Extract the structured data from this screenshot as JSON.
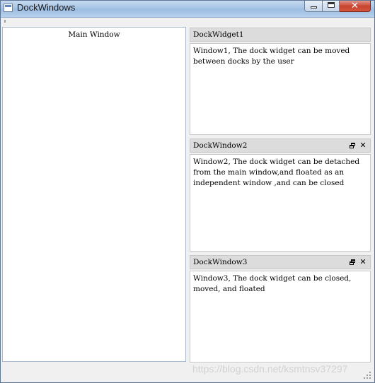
{
  "window": {
    "title": "DockWindows",
    "controls": {
      "minimize": "minimize",
      "maximize": "maximize",
      "close": "✕"
    }
  },
  "central": {
    "label": "Main Window"
  },
  "docks": [
    {
      "title": "DockWidget1",
      "text": "Window1, The dock widget can be moved between docks by the user",
      "has_float_button": false,
      "has_close_button": false
    },
    {
      "title": "DockWindow2",
      "text": "Window2, The dock widget can be detached from the main window,and floated as an independent window ,and can be closed",
      "has_float_button": true,
      "has_close_button": true,
      "close_glyph": "✕"
    },
    {
      "title": "DockWindow3",
      "text": "Window3, The dock widget can be closed, moved, and floated",
      "has_float_button": true,
      "has_close_button": true,
      "close_glyph": "✕"
    }
  ],
  "watermark": "https://blog.csdn.net/ksmtnsv37297",
  "colors": {
    "title_bar": "#a9c6e6",
    "dock_title_bg": "#dcdcdc",
    "content_bg": "#ffffff",
    "close_button": "#c8442f"
  }
}
